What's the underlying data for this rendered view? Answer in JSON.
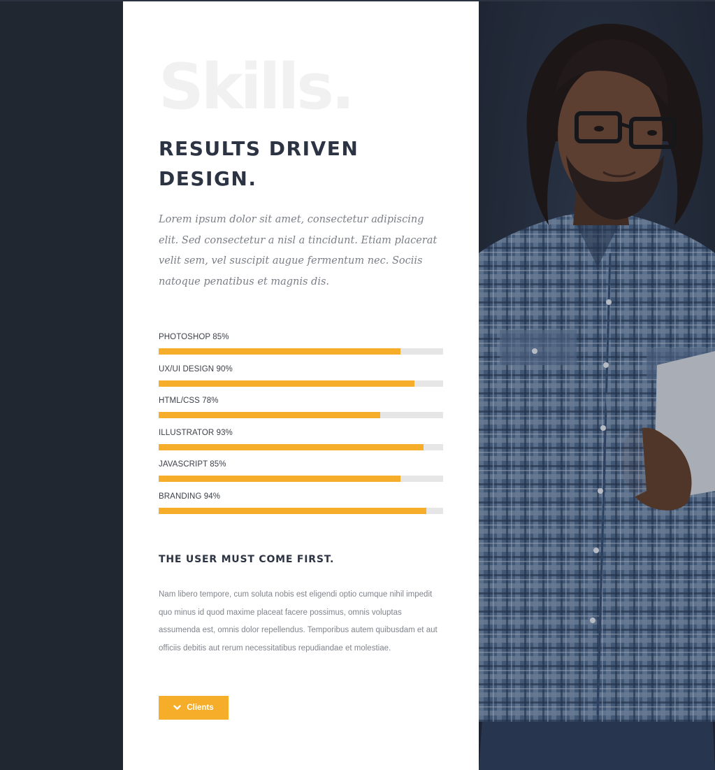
{
  "section": {
    "background_word": "Skills.",
    "headline": "RESULTS DRIVEN DESIGN.",
    "intro": "Lorem ipsum dolor sit amet, consectetur adipiscing elit. Sed consectetur a nisl a tincidunt. Etiam placerat velit sem, vel suscipit augue fermentum nec. Sociis natoque penatibus et magnis dis."
  },
  "skills": [
    {
      "label": "PHOTOSHOP 85%",
      "percent": 85
    },
    {
      "label": "UX/UI DESIGN 90%",
      "percent": 90
    },
    {
      "label": "HTML/CSS 78%",
      "percent": 78
    },
    {
      "label": "ILLUSTRATOR 93%",
      "percent": 93
    },
    {
      "label": "JAVASCRIPT 85%",
      "percent": 85
    },
    {
      "label": "BRANDING 94%",
      "percent": 94
    }
  ],
  "subsection": {
    "heading": "THE USER MUST COME FIRST.",
    "body": "Nam libero tempore, cum soluta nobis est eligendi optio cumque nihil impedit quo minus id quod maxime placeat facere possimus, omnis voluptas assumenda est, omnis dolor repellendus. Temporibus autem quibusdam et aut officiis debitis aut rerum necessitatibus repudiandae et molestiae."
  },
  "clients_button": {
    "label": "Clients",
    "icon": "chevron-down-icon"
  },
  "colors": {
    "accent": "#f5ad2a",
    "dark_background": "#212731",
    "panel": "#ffffff",
    "heading": "#2c3342",
    "track": "#e6e6e6"
  },
  "photo": {
    "icon": "portrait-photo"
  }
}
